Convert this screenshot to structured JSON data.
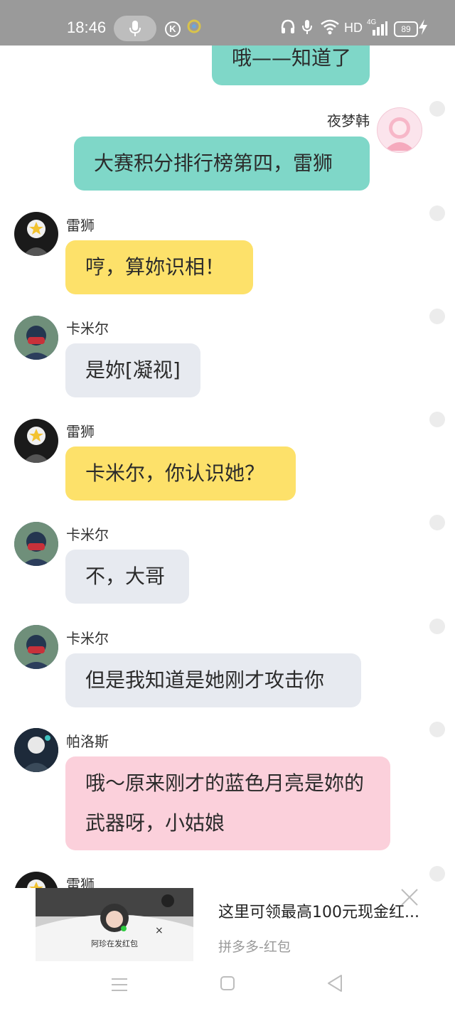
{
  "status": {
    "time": "18:46",
    "network": "HD",
    "cell": "4G",
    "battery": "89",
    "icons": [
      "mic-icon",
      "k-app-icon",
      "assistant-icon",
      "headphones-icon",
      "mic-small-icon",
      "wifi-icon",
      "signal-icon",
      "battery-icon",
      "charging-icon"
    ]
  },
  "messages": [
    {
      "side": "right",
      "text": "哦——知道了"
    },
    {
      "side": "right",
      "sender": "夜梦韩",
      "text": "大赛积分排行榜第四，雷狮"
    },
    {
      "side": "left",
      "sender": "雷狮",
      "text": "哼，算妳识相！"
    },
    {
      "side": "left",
      "sender": "卡米尔",
      "text": "是妳[凝视]"
    },
    {
      "side": "left",
      "sender": "雷狮",
      "text": "卡米尔，你认识她？"
    },
    {
      "side": "left",
      "sender": "卡米尔",
      "text": "不，大哥"
    },
    {
      "side": "left",
      "sender": "卡米尔",
      "text": "但是我知道是她刚才攻击你"
    },
    {
      "side": "left",
      "sender": "帕洛斯",
      "text": "哦～原来刚才的蓝色月亮是妳的武器呀，小姑娘"
    },
    {
      "side": "left",
      "sender": "雷狮",
      "text": ""
    }
  ],
  "colors": {
    "teal": "#7fd7c8",
    "yellow": "#fde16a",
    "gray": "#e7eaf0",
    "pink": "#fbd0db",
    "statusbar": "#9a9a9a"
  },
  "ad": {
    "title": "这里可领最高100元现金红...",
    "subtitle": "拼多多-红包",
    "image_caption": "阿珍在发红包"
  },
  "nav": [
    "menu-icon",
    "home-icon",
    "back-icon"
  ]
}
